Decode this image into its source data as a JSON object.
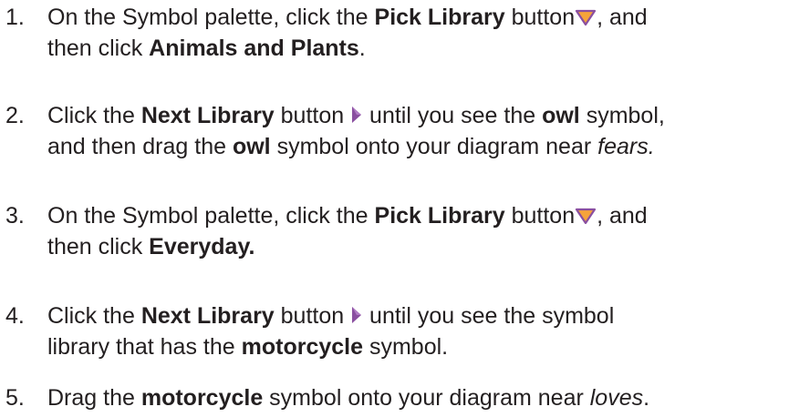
{
  "steps": [
    {
      "number": "1.",
      "line1": {
        "a": "On the Symbol palette, click the ",
        "b": "Pick Library",
        "c": " button",
        "icon": "pick-library-triangle-icon",
        "d": ", and"
      },
      "line2": {
        "a": "then click ",
        "b": "Animals and Plants",
        "c": "."
      }
    },
    {
      "number": "2.",
      "line1": {
        "a": "Click the ",
        "b": "Next Library",
        "c": " button ",
        "icon": "next-library-arrow-icon",
        "d": " until you see the ",
        "e": "owl",
        "f": " symbol,"
      },
      "line2": {
        "a": "and then drag the ",
        "b": "owl",
        "c": " symbol onto your diagram near ",
        "d": "fears."
      }
    },
    {
      "number": "3.",
      "line1": {
        "a": "On the Symbol palette, click the ",
        "b": "Pick Library",
        "c": " button",
        "icon": "pick-library-triangle-icon",
        "d": ", and"
      },
      "line2": {
        "a": "then click ",
        "b": "Everyday."
      }
    },
    {
      "number": "4.",
      "line1": {
        "a": "Click the ",
        "b": "Next Library",
        "c": " button ",
        "icon": "next-library-arrow-icon",
        "d": " until you see the symbol"
      },
      "line2": {
        "a": "library that has the ",
        "b": "motorcycle",
        "c": " symbol."
      }
    },
    {
      "number": "5.",
      "line1": {
        "a": "Drag the ",
        "b": "motorcycle",
        "c": " symbol onto your diagram near ",
        "d": "loves",
        "e": "."
      }
    }
  ],
  "colors": {
    "text": "#231f20",
    "pick_library_icon_fill": "#f5a33a",
    "pick_library_icon_stroke": "#8a4fa0",
    "next_library_icon_fill": "#8a4fa0"
  }
}
